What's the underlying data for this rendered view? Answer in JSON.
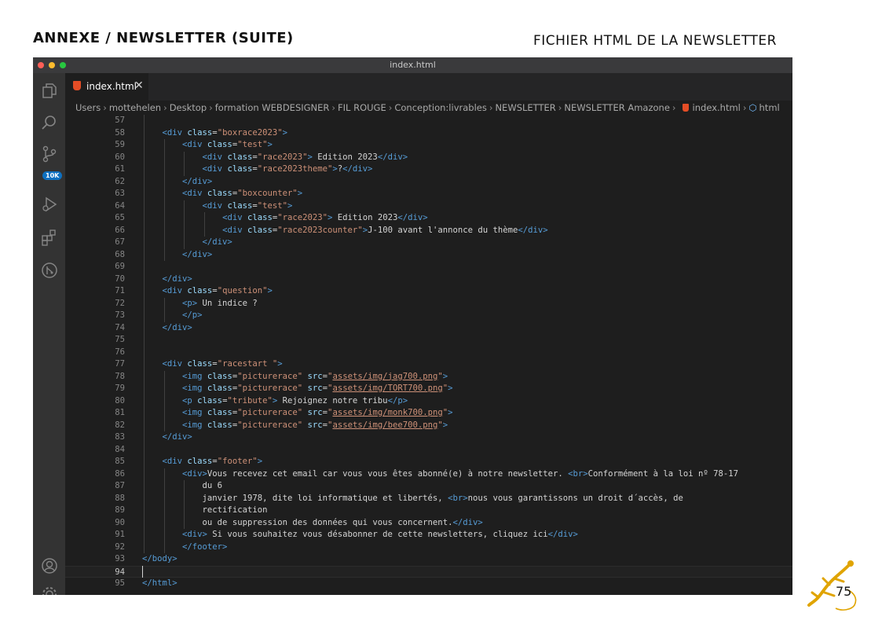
{
  "page": {
    "title": "ANNEXE / NEWSLETTER (SUITE)",
    "subtitle": "FICHIER HTML DE LA NEWSLETTER",
    "page_number": "75"
  },
  "window": {
    "title": "index.html"
  },
  "activity_bar": {
    "items": [
      "explorer-icon",
      "search-icon",
      "source-control-icon",
      "run-debug-icon",
      "extensions-icon",
      "git-graph-icon",
      "account-icon",
      "settings-icon"
    ],
    "badge": "10K"
  },
  "tab": {
    "label": "index.html",
    "close": "✕"
  },
  "breadcrumbs": [
    "Users",
    "mottehelen",
    "Desktop",
    "formation WEBDESIGNER",
    "FIL ROUGE",
    "Conception:livrables",
    "NEWSLETTER",
    "NEWSLETTER Amazone",
    "index.html",
    "html"
  ],
  "editor": {
    "current_line": 94,
    "lines": [
      {
        "n": "57",
        "indent": 2,
        "t": []
      },
      {
        "n": "58",
        "indent": 2,
        "t": [
          [
            "tag",
            "<div "
          ],
          [
            "attr",
            "class"
          ],
          [
            "txt",
            "="
          ],
          [
            "str",
            "\"boxrace2023\""
          ],
          [
            "tag",
            ">"
          ]
        ]
      },
      {
        "n": "59",
        "indent": 3,
        "t": [
          [
            "tag",
            "<div "
          ],
          [
            "attr",
            "class"
          ],
          [
            "txt",
            "="
          ],
          [
            "str",
            "\"test\""
          ],
          [
            "tag",
            ">"
          ]
        ]
      },
      {
        "n": "60",
        "indent": 4,
        "t": [
          [
            "tag",
            "<div "
          ],
          [
            "attr",
            "class"
          ],
          [
            "txt",
            "="
          ],
          [
            "str",
            "\"race2023\""
          ],
          [
            "tag",
            ">"
          ],
          [
            "txt",
            " Edition 2023"
          ],
          [
            "tag",
            "</div>"
          ]
        ]
      },
      {
        "n": "61",
        "indent": 4,
        "t": [
          [
            "tag",
            "<div "
          ],
          [
            "attr",
            "class"
          ],
          [
            "txt",
            "="
          ],
          [
            "str",
            "\"race2023theme\""
          ],
          [
            "tag",
            ">"
          ],
          [
            "txt",
            "?"
          ],
          [
            "tag",
            "</div>"
          ]
        ]
      },
      {
        "n": "62",
        "indent": 3,
        "t": [
          [
            "tag",
            "</div>"
          ]
        ]
      },
      {
        "n": "63",
        "indent": 3,
        "t": [
          [
            "tag",
            "<div "
          ],
          [
            "attr",
            "class"
          ],
          [
            "txt",
            "="
          ],
          [
            "str",
            "\"boxcounter\""
          ],
          [
            "tag",
            ">"
          ]
        ]
      },
      {
        "n": "64",
        "indent": 4,
        "t": [
          [
            "tag",
            "<div "
          ],
          [
            "attr",
            "class"
          ],
          [
            "txt",
            "="
          ],
          [
            "str",
            "\"test\""
          ],
          [
            "tag",
            ">"
          ]
        ]
      },
      {
        "n": "65",
        "indent": 5,
        "t": [
          [
            "tag",
            "<div "
          ],
          [
            "attr",
            "class"
          ],
          [
            "txt",
            "="
          ],
          [
            "str",
            "\"race2023\""
          ],
          [
            "tag",
            ">"
          ],
          [
            "txt",
            " Edition 2023"
          ],
          [
            "tag",
            "</div>"
          ]
        ]
      },
      {
        "n": "66",
        "indent": 5,
        "t": [
          [
            "tag",
            "<div "
          ],
          [
            "attr",
            "class"
          ],
          [
            "txt",
            "="
          ],
          [
            "str",
            "\"race2023counter\""
          ],
          [
            "tag",
            ">"
          ],
          [
            "txt",
            "J-100 avant l'annonce du thème"
          ],
          [
            "tag",
            "</div>"
          ]
        ]
      },
      {
        "n": "67",
        "indent": 4,
        "t": [
          [
            "tag",
            "</div>"
          ]
        ]
      },
      {
        "n": "68",
        "indent": 3,
        "t": [
          [
            "tag",
            "</div>"
          ]
        ]
      },
      {
        "n": "69",
        "indent": 2,
        "t": []
      },
      {
        "n": "70",
        "indent": 2,
        "t": [
          [
            "tag",
            "</div>"
          ]
        ]
      },
      {
        "n": "71",
        "indent": 2,
        "t": [
          [
            "tag",
            "<div "
          ],
          [
            "attr",
            "class"
          ],
          [
            "txt",
            "="
          ],
          [
            "str",
            "\"question\""
          ],
          [
            "tag",
            ">"
          ]
        ]
      },
      {
        "n": "72",
        "indent": 3,
        "t": [
          [
            "tag",
            "<p>"
          ],
          [
            "txt",
            " Un indice ?"
          ]
        ]
      },
      {
        "n": "73",
        "indent": 3,
        "t": [
          [
            "tag",
            "</p>"
          ]
        ]
      },
      {
        "n": "74",
        "indent": 2,
        "t": [
          [
            "tag",
            "</div>"
          ]
        ]
      },
      {
        "n": "75",
        "indent": 2,
        "t": []
      },
      {
        "n": "76",
        "indent": 2,
        "t": []
      },
      {
        "n": "77",
        "indent": 2,
        "t": [
          [
            "tag",
            "<div "
          ],
          [
            "attr",
            "class"
          ],
          [
            "txt",
            "="
          ],
          [
            "str",
            "\"racestart \""
          ],
          [
            "tag",
            ">"
          ]
        ]
      },
      {
        "n": "78",
        "indent": 3,
        "t": [
          [
            "tag",
            "<img "
          ],
          [
            "attr",
            "class"
          ],
          [
            "txt",
            "="
          ],
          [
            "str",
            "\"picturerace\""
          ],
          [
            "txt",
            " "
          ],
          [
            "attr",
            "src"
          ],
          [
            "txt",
            "="
          ],
          [
            "str",
            "\""
          ],
          [
            "link",
            "assets/img/jag700.png"
          ],
          [
            "str",
            "\""
          ],
          [
            "tag",
            ">"
          ]
        ]
      },
      {
        "n": "79",
        "indent": 3,
        "t": [
          [
            "tag",
            "<img "
          ],
          [
            "attr",
            "class"
          ],
          [
            "txt",
            "="
          ],
          [
            "str",
            "\"picturerace\""
          ],
          [
            "txt",
            " "
          ],
          [
            "attr",
            "src"
          ],
          [
            "txt",
            "="
          ],
          [
            "str",
            "\""
          ],
          [
            "link",
            "assets/img/TORT700.png"
          ],
          [
            "str",
            "\""
          ],
          [
            "tag",
            ">"
          ]
        ]
      },
      {
        "n": "80",
        "indent": 3,
        "t": [
          [
            "tag",
            "<p "
          ],
          [
            "attr",
            "class"
          ],
          [
            "txt",
            "="
          ],
          [
            "str",
            "\"tribute\""
          ],
          [
            "tag",
            ">"
          ],
          [
            "txt",
            " Rejoignez notre tribu"
          ],
          [
            "tag",
            "</p>"
          ]
        ]
      },
      {
        "n": "81",
        "indent": 3,
        "t": [
          [
            "tag",
            "<img "
          ],
          [
            "attr",
            "class"
          ],
          [
            "txt",
            "="
          ],
          [
            "str",
            "\"picturerace\""
          ],
          [
            "txt",
            " "
          ],
          [
            "attr",
            "src"
          ],
          [
            "txt",
            "="
          ],
          [
            "str",
            "\""
          ],
          [
            "link",
            "assets/img/monk700.png"
          ],
          [
            "str",
            "\""
          ],
          [
            "tag",
            ">"
          ]
        ]
      },
      {
        "n": "82",
        "indent": 3,
        "t": [
          [
            "tag",
            "<img "
          ],
          [
            "attr",
            "class"
          ],
          [
            "txt",
            "="
          ],
          [
            "str",
            "\"picturerace\""
          ],
          [
            "txt",
            " "
          ],
          [
            "attr",
            "src"
          ],
          [
            "txt",
            "="
          ],
          [
            "str",
            "\""
          ],
          [
            "link",
            "assets/img/bee700.png"
          ],
          [
            "str",
            "\""
          ],
          [
            "tag",
            ">"
          ]
        ]
      },
      {
        "n": "83",
        "indent": 2,
        "t": [
          [
            "tag",
            "</div>"
          ]
        ]
      },
      {
        "n": "84",
        "indent": 2,
        "t": []
      },
      {
        "n": "85",
        "indent": 2,
        "t": [
          [
            "tag",
            "<div "
          ],
          [
            "attr",
            "class"
          ],
          [
            "txt",
            "="
          ],
          [
            "str",
            "\"footer\""
          ],
          [
            "tag",
            ">"
          ]
        ]
      },
      {
        "n": "86",
        "indent": 3,
        "t": [
          [
            "tag",
            "<div>"
          ],
          [
            "txt",
            "Vous recevez cet email car vous vous êtes abonné(e) à notre newsletter. "
          ],
          [
            "tag",
            "<br>"
          ],
          [
            "txt",
            "Conformément à la loi nº 78-17"
          ]
        ]
      },
      {
        "n": "87",
        "indent": 4,
        "t": [
          [
            "txt",
            "du 6"
          ]
        ]
      },
      {
        "n": "88",
        "indent": 4,
        "t": [
          [
            "txt",
            "janvier 1978, dite loi informatique et libertés, "
          ],
          [
            "tag",
            "<br>"
          ],
          [
            "txt",
            "nous vous garantissons un droit d´accès, de"
          ]
        ]
      },
      {
        "n": "89",
        "indent": 4,
        "t": [
          [
            "txt",
            "rectification"
          ]
        ]
      },
      {
        "n": "90",
        "indent": 4,
        "t": [
          [
            "txt",
            "ou de suppression des données qui vous concernent."
          ],
          [
            "tag",
            "</div>"
          ]
        ]
      },
      {
        "n": "91",
        "indent": 3,
        "t": [
          [
            "tag",
            "<div>"
          ],
          [
            "txt",
            " Si vous souhaitez vous désabonner de cette newsletters, cliquez ici"
          ],
          [
            "tag",
            "</div>"
          ]
        ]
      },
      {
        "n": "92",
        "indent": 3,
        "t": [
          [
            "tag",
            "</footer>"
          ]
        ]
      },
      {
        "n": "93",
        "indent": 1,
        "t": [
          [
            "tag",
            "</body>"
          ]
        ]
      },
      {
        "n": "94",
        "indent": 1,
        "t": []
      },
      {
        "n": "95",
        "indent": 1,
        "t": [
          [
            "tag",
            "</html>"
          ]
        ]
      }
    ]
  }
}
